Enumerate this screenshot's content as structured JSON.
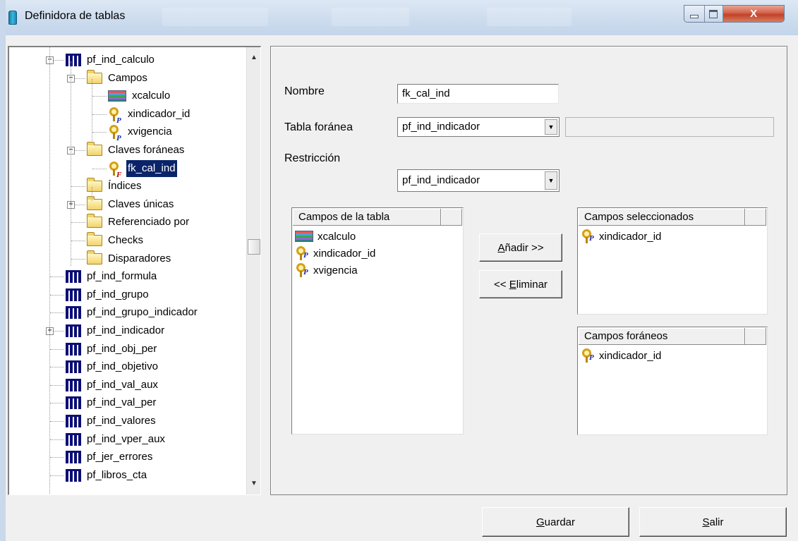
{
  "window": {
    "title": "Definidora de tablas",
    "close_glyph": "X"
  },
  "tree": {
    "items": [
      {
        "label": "pf_ind_calculo",
        "icon": "table-icon",
        "expander": "−"
      },
      {
        "label": "Campos",
        "icon": "folder-icon",
        "expander": "−"
      },
      {
        "label": "xcalculo",
        "icon": "column-icon"
      },
      {
        "label": "xindicador_id",
        "icon": "primary-key-icon",
        "key_letter": "P"
      },
      {
        "label": "xvigencia",
        "icon": "primary-key-icon",
        "key_letter": "P"
      },
      {
        "label": "Claves foráneas",
        "icon": "folder-icon",
        "expander": "−"
      },
      {
        "label": "fk_cal_ind",
        "icon": "foreign-key-icon",
        "key_letter": "F",
        "selected": true
      },
      {
        "label": "Índices",
        "icon": "folder-icon"
      },
      {
        "label": "Claves únicas",
        "icon": "folder-icon",
        "expander": "+"
      },
      {
        "label": "Referenciado por",
        "icon": "folder-icon"
      },
      {
        "label": "Checks",
        "icon": "folder-icon"
      },
      {
        "label": "Disparadores",
        "icon": "folder-icon"
      },
      {
        "label": "pf_ind_formula",
        "icon": "table-icon"
      },
      {
        "label": "pf_ind_grupo",
        "icon": "table-icon"
      },
      {
        "label": "pf_ind_grupo_indicador",
        "icon": "table-icon"
      },
      {
        "label": "pf_ind_indicador",
        "icon": "table-icon",
        "expander": "+"
      },
      {
        "label": "pf_ind_obj_per",
        "icon": "table-icon"
      },
      {
        "label": "pf_ind_objetivo",
        "icon": "table-icon"
      },
      {
        "label": "pf_ind_val_aux",
        "icon": "table-icon"
      },
      {
        "label": "pf_ind_val_per",
        "icon": "table-icon"
      },
      {
        "label": "pf_ind_valores",
        "icon": "table-icon"
      },
      {
        "label": "pf_ind_vper_aux",
        "icon": "table-icon"
      },
      {
        "label": "pf_jer_errores",
        "icon": "table-icon"
      },
      {
        "label": "pf_libros_cta",
        "icon": "table-icon"
      }
    ]
  },
  "form": {
    "nombre_label": "Nombre",
    "nombre_value": "fk_cal_ind",
    "tabla_label": "Tabla foránea",
    "tabla_value": "pf_ind_indicador",
    "restriccion_label": "Restricción",
    "restriccion_value": "pf_ind_indicador"
  },
  "lists": {
    "campos_tabla": {
      "header": "Campos de la tabla",
      "items": [
        {
          "label": "xcalculo",
          "icon": "column-icon"
        },
        {
          "label": "xindicador_id",
          "icon": "primary-key-icon",
          "key_letter": "P"
        },
        {
          "label": "xvigencia",
          "icon": "primary-key-icon",
          "key_letter": "P"
        }
      ]
    },
    "campos_seleccionados": {
      "header": "Campos seleccionados",
      "items": [
        {
          "label": "xindicador_id",
          "icon": "primary-key-icon",
          "key_letter": "P"
        }
      ]
    },
    "campos_foraneos": {
      "header": "Campos foráneos",
      "items": [
        {
          "label": "xindicador_id",
          "icon": "primary-key-icon",
          "key_letter": "P"
        }
      ]
    }
  },
  "buttons": {
    "anadir_mnemonic": "A",
    "anadir_rest": "ñadir >>",
    "eliminar_prefix": "<< ",
    "eliminar_mnemonic": "E",
    "eliminar_rest": "liminar",
    "guardar_mnemonic": "G",
    "guardar_rest": "uardar",
    "salir_mnemonic": "S",
    "salir_rest": "alir"
  }
}
